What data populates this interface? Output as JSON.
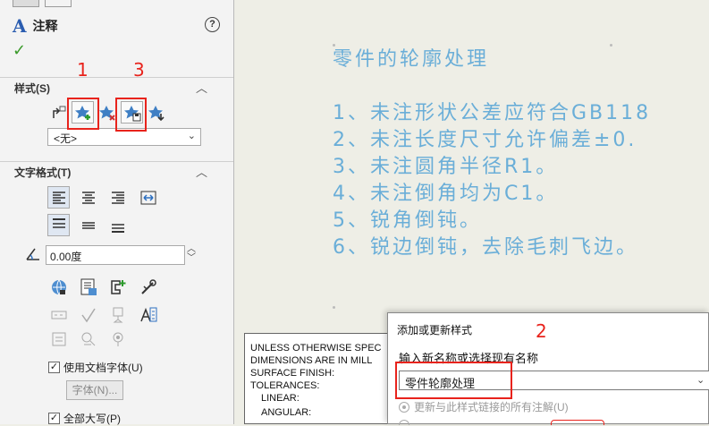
{
  "panel": {
    "title": "注释",
    "sections": {
      "style": "样式(S)",
      "text_format": "文字格式(T)"
    },
    "style_select": "<无>",
    "angle_value": "0.00度",
    "use_doc_font": "使用文档字体(U)",
    "font_button": "字体(N)...",
    "all_caps": "全部大写(P)"
  },
  "annotations": {
    "n1": "1",
    "n2": "2",
    "n3": "3",
    "color": "#e8231c"
  },
  "notes": {
    "title": "零件的轮廓处理",
    "items": [
      "1、未注形状公差应符合GB118",
      "2、未注长度尺寸允许偏差±0.",
      "3、未注圆角半径R1。",
      "4、未注倒角均为C1。",
      "5、锐角倒钝。",
      "6、锐边倒钝，去除毛刺飞边。"
    ],
    "color": "#6aaed8"
  },
  "title_block": {
    "lines": [
      "UNLESS OTHERWISE SPEC",
      "DIMENSIONS ARE IN MILL",
      "SURFACE FINISH:",
      "TOLERANCES:",
      "LINEAR:",
      "ANGULAR:"
    ]
  },
  "dialog": {
    "title": "添加或更新样式",
    "prompt": "输入新名称或选择现有名称",
    "input_value": "零件轮廓处理",
    "radio_label": "更新与此样式链接的所有注解(U)"
  }
}
